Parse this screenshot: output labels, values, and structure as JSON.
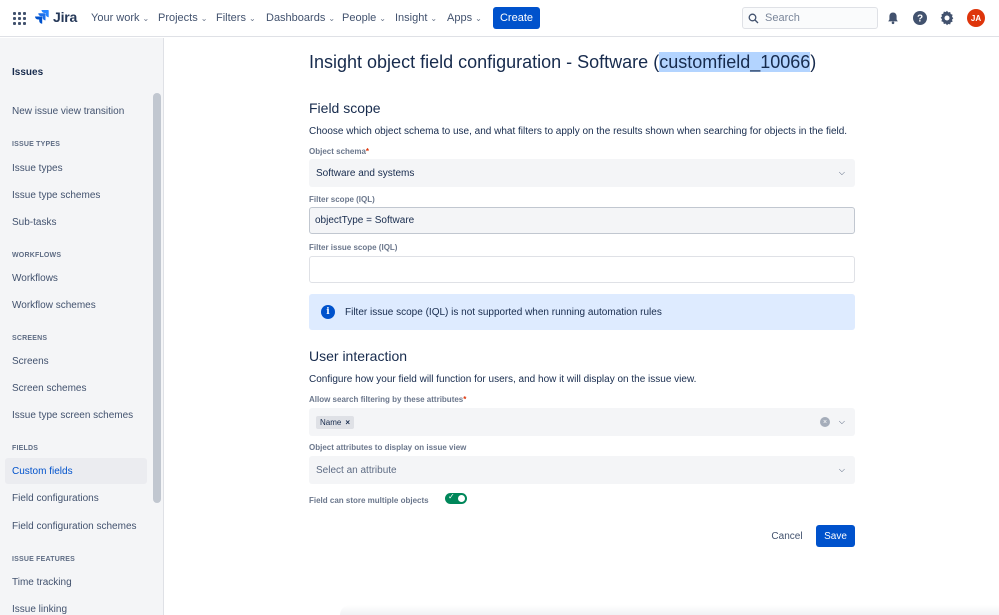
{
  "topnav": {
    "logo_text": "Jira",
    "items": [
      {
        "label": "Your work"
      },
      {
        "label": "Projects"
      },
      {
        "label": "Filters"
      },
      {
        "label": "Dashboards"
      },
      {
        "label": "People"
      },
      {
        "label": "Insight"
      },
      {
        "label": "Apps"
      }
    ],
    "create_label": "Create",
    "search_placeholder": "Search",
    "avatar_initials": "JA",
    "icons": [
      "app-switcher-icon",
      "notification-bell-icon",
      "help-icon",
      "settings-gear-icon"
    ]
  },
  "sidebar": {
    "title": "Issues",
    "items_top": [
      {
        "label": "New issue view transition"
      }
    ],
    "sections": [
      {
        "heading": "ISSUE TYPES",
        "items": [
          {
            "label": "Issue types"
          },
          {
            "label": "Issue type schemes"
          },
          {
            "label": "Sub-tasks"
          }
        ]
      },
      {
        "heading": "WORKFLOWS",
        "items": [
          {
            "label": "Workflows"
          },
          {
            "label": "Workflow schemes"
          }
        ]
      },
      {
        "heading": "SCREENS",
        "items": [
          {
            "label": "Screens"
          },
          {
            "label": "Screen schemes"
          },
          {
            "label": "Issue type screen schemes"
          }
        ]
      },
      {
        "heading": "FIELDS",
        "items": [
          {
            "label": "Custom fields"
          },
          {
            "label": "Field configurations"
          },
          {
            "label": "Field configuration schemes"
          }
        ]
      },
      {
        "heading": "ISSUE FEATURES",
        "items": [
          {
            "label": "Time tracking"
          },
          {
            "label": "Issue linking"
          }
        ]
      }
    ],
    "active_item": "Custom fields"
  },
  "main": {
    "title_prefix": "Insight object field configuration - Software (",
    "title_highlight": "customfield_10066",
    "title_suffix": ")",
    "field_scope": {
      "heading": "Field scope",
      "description": "Choose which object schema to use, and what filters to apply on the results shown when searching for objects in the field.",
      "object_schema_label": "Object schema",
      "object_schema_value": "Software and systems",
      "filter_scope_label": "Filter scope (IQL)",
      "filter_scope_value": "objectType = Software",
      "filter_issue_scope_label": "Filter issue scope (IQL)",
      "filter_issue_scope_value": "",
      "info_message": "Filter issue scope (IQL) is not supported when running automation rules"
    },
    "user_interaction": {
      "heading": "User interaction",
      "description": "Configure how your field will function for users, and how it will display on the issue view.",
      "search_attrs_label": "Allow search filtering by these attributes",
      "search_attrs_tags": [
        "Name"
      ],
      "display_attrs_label": "Object attributes to display on issue view",
      "display_attrs_placeholder": "Select an attribute",
      "multiple_label": "Field can store multiple objects",
      "multiple_enabled": true
    },
    "required_marker": "*",
    "cancel_label": "Cancel",
    "save_label": "Save"
  }
}
